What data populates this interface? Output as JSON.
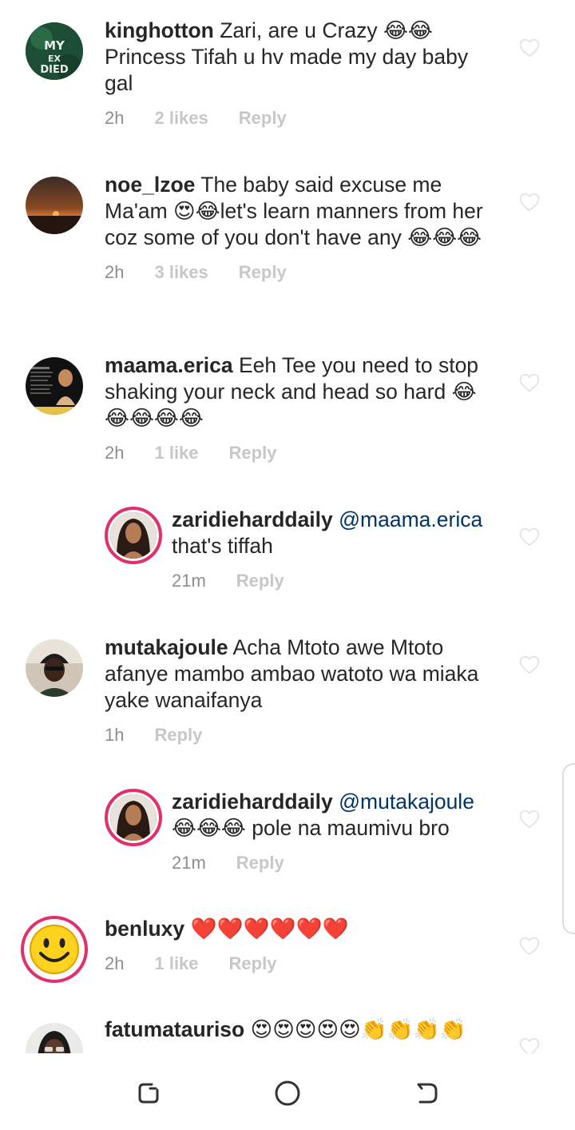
{
  "comments": [
    {
      "username": "kinghotton",
      "text": "Zari, are u Crazy 😂😂 Princess Tifah u hv made my day baby gal",
      "time": "2h",
      "likes": "2 likes",
      "reply": "Reply",
      "avatar_text": "MY EX DIED",
      "avatar_icon": "avatar-kinghotton"
    },
    {
      "username": "noe_lzoe",
      "text": "The baby said excuse me Ma'am 😍😂let's learn manners from her coz some of you don't have any 😂😂😂",
      "time": "2h",
      "likes": "3 likes",
      "reply": "Reply",
      "avatar_icon": "avatar-sunset"
    },
    {
      "username": "maama.erica",
      "text": "Eeh Tee you need to stop shaking your neck and head so hard 😂😂😂😂😂",
      "time": "2h",
      "likes": "1 like",
      "reply": "Reply",
      "avatar_icon": "avatar-maama-erica"
    },
    {
      "username": "zaridiehard daily",
      "username_display": "zaridieharddaily",
      "mention": "@maama.erica",
      "text": "that's tiffah",
      "time": "21m",
      "reply": "Reply",
      "is_reply": true,
      "avatar_icon": "avatar-zari"
    },
    {
      "username": "mutakajoule",
      "text": "Acha Mtoto awe Mtoto afanye mambo ambao watoto wa miaka yake wanaifanya",
      "time": "1h",
      "reply": "Reply",
      "avatar_icon": "avatar-mutakajoule"
    },
    {
      "username_display": "zaridieharddaily",
      "mention": "@mutakajoule",
      "text": "😂😂😂 pole na maumivu bro",
      "time": "21m",
      "reply": "Reply",
      "is_reply": true,
      "avatar_icon": "avatar-zari"
    },
    {
      "username": "benluxy",
      "text": "❤️❤️❤️❤️❤️❤️",
      "time": "2h",
      "likes": "1 like",
      "reply": "Reply",
      "avatar_icon": "avatar-smiley"
    },
    {
      "username": "fatumatauriso",
      "text": "😍😍😍😍😍👏👏👏👏",
      "avatar_icon": "avatar-fatuma"
    }
  ],
  "colors": {
    "text": "#262626",
    "meta": "#8e8e8e",
    "meta_light": "#c7c7c7",
    "mention": "#003569",
    "story_ring": "#e1306c"
  },
  "icons": {
    "like": "heart-outline-icon",
    "nav_recent": "recent-apps-icon",
    "nav_home": "home-circle-icon",
    "nav_back": "back-icon"
  }
}
